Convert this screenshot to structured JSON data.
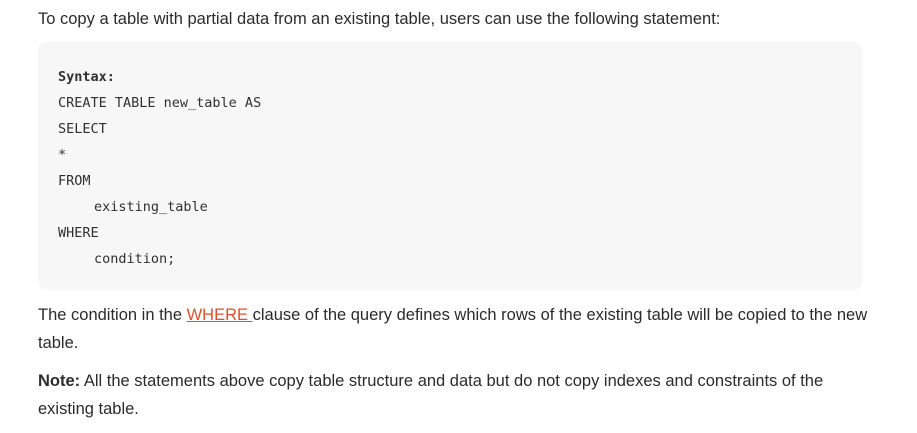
{
  "intro_text": "To copy a table with partial data from an existing table, users can use the following statement:",
  "code": {
    "label": "Syntax:",
    "lines": [
      {
        "text": "CREATE TABLE new_table AS",
        "indent": false
      },
      {
        "text": "SELECT",
        "indent": false
      },
      {
        "text": "*",
        "indent": false
      },
      {
        "text": "FROM",
        "indent": false
      },
      {
        "text": "existing_table",
        "indent": true
      },
      {
        "text": "WHERE",
        "indent": false
      },
      {
        "text": "condition;",
        "indent": true
      }
    ]
  },
  "paragraph1": {
    "before": "The condition in the ",
    "link": "WHERE ",
    "after": "clause of the query defines which rows of the existing table will be copied to the new table."
  },
  "note": {
    "label": "Note:",
    "text": " All the statements above copy table structure and data but do not copy indexes and constraints of the existing table."
  },
  "colors": {
    "link": "#e0502a",
    "code_bg": "#f7f7f7",
    "text": "#2b2b2b"
  }
}
